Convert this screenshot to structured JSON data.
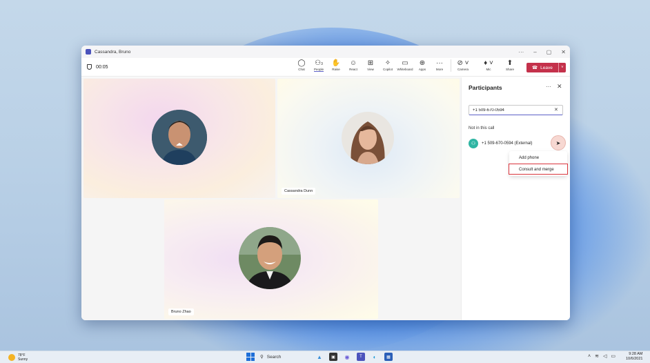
{
  "window": {
    "title": "Cassandra, Bruno",
    "controls": [
      "···",
      "–",
      "▢",
      "✕"
    ]
  },
  "toolbar": {
    "timer": "00:05",
    "tools": [
      {
        "icon": "chat-icon",
        "glyph": "💬",
        "label": "Chat"
      },
      {
        "icon": "people-icon",
        "glyph": "👥",
        "label": "People",
        "count": "3"
      },
      {
        "icon": "raise-hand-icon",
        "glyph": "✋",
        "label": "Raise"
      },
      {
        "icon": "react-icon",
        "glyph": "☺",
        "label": "React"
      },
      {
        "icon": "view-icon",
        "glyph": "⊞",
        "label": "View"
      },
      {
        "icon": "copilot-icon",
        "glyph": "✧",
        "label": "Copilot"
      },
      {
        "icon": "whiteboard-icon",
        "glyph": "▭",
        "label": "Whiteboard"
      },
      {
        "icon": "apps-icon",
        "glyph": "⊕",
        "label": "Apps"
      },
      {
        "icon": "more-icon",
        "glyph": "···",
        "label": "More"
      }
    ],
    "camera_label": "Camera",
    "mic_label": "Mic",
    "share_label": "Share",
    "leave_label": "Leave"
  },
  "stage": {
    "participants": [
      {
        "name": ""
      },
      {
        "name": "Cassandra Dunn"
      },
      {
        "name": "Bruno Zhao"
      }
    ]
  },
  "panel": {
    "title": "Participants",
    "search_value": "+1 509-670-0594",
    "section": "Not in this call",
    "person": "+1 509-670-0594 (External)",
    "menu": [
      "Add phone",
      "Consult and merge"
    ]
  },
  "taskbar": {
    "weather_temp": "78°F",
    "weather_desc": "Sunny",
    "search_label": "Search",
    "time": "9:28 AM",
    "date": "10/6/2021"
  }
}
